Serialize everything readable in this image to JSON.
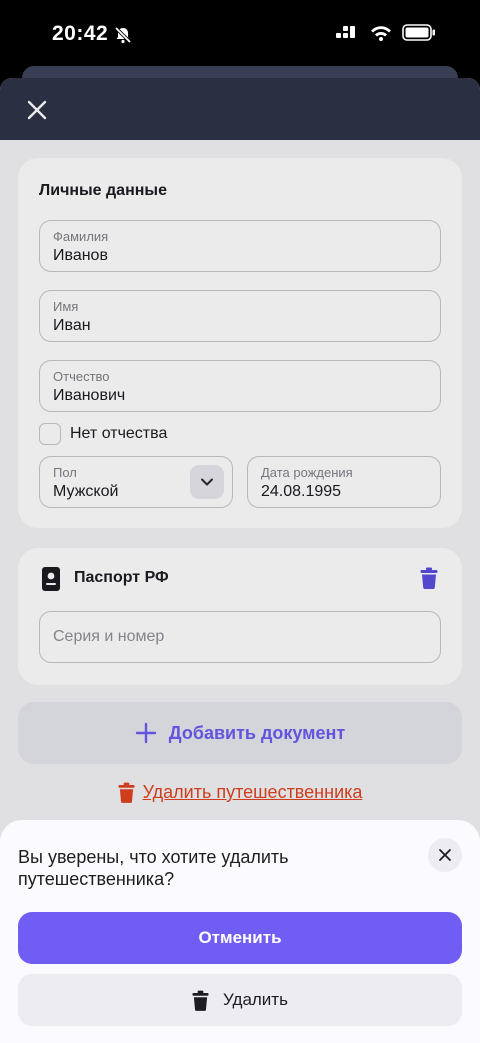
{
  "status_bar": {
    "time": "20:42"
  },
  "personal": {
    "title": "Личные данные",
    "surname": {
      "label": "Фамилия",
      "value": "Иванов"
    },
    "name": {
      "label": "Имя",
      "value": "Иван"
    },
    "patronymic": {
      "label": "Отчество",
      "value": "Иванович"
    },
    "no_patronymic_label": "Нет отчества",
    "gender": {
      "label": "Пол",
      "value": "Мужской"
    },
    "birth_date": {
      "label": "Дата рождения",
      "value": "24.08.1995"
    }
  },
  "passport": {
    "title": "Паспорт РФ",
    "number_placeholder": "Серия и номер"
  },
  "add_document_label": "Добавить документ",
  "delete_traveler_label": "Удалить путешественника",
  "dialog": {
    "title": "Вы уверены, что хотите удалить путешественника?",
    "cancel_label": "Отменить",
    "delete_label": "Удалить"
  },
  "colors": {
    "accent": "#6f5df4",
    "danger": "#e0431f",
    "header": "#2f3448"
  }
}
